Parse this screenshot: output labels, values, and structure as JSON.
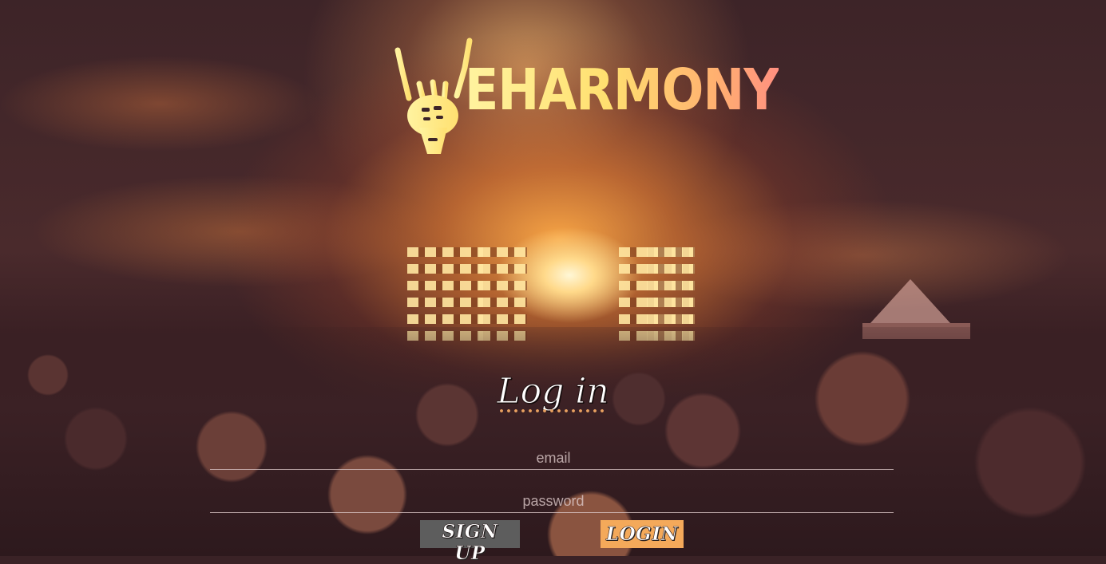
{
  "logo": {
    "icon": "skeleton-rock-hand-icon",
    "text": "EHARMONY"
  },
  "form": {
    "title": "Log in",
    "email_placeholder": "email",
    "password_placeholder": "password"
  },
  "buttons": {
    "signup_label": "SIGN UP",
    "login_label": "LOGIN"
  },
  "colors": {
    "login_button": "#f4a95a",
    "signup_button": "#5d5d5d",
    "logo_gradient_start": "#fff3a0",
    "logo_gradient_end": "#ff9080"
  }
}
